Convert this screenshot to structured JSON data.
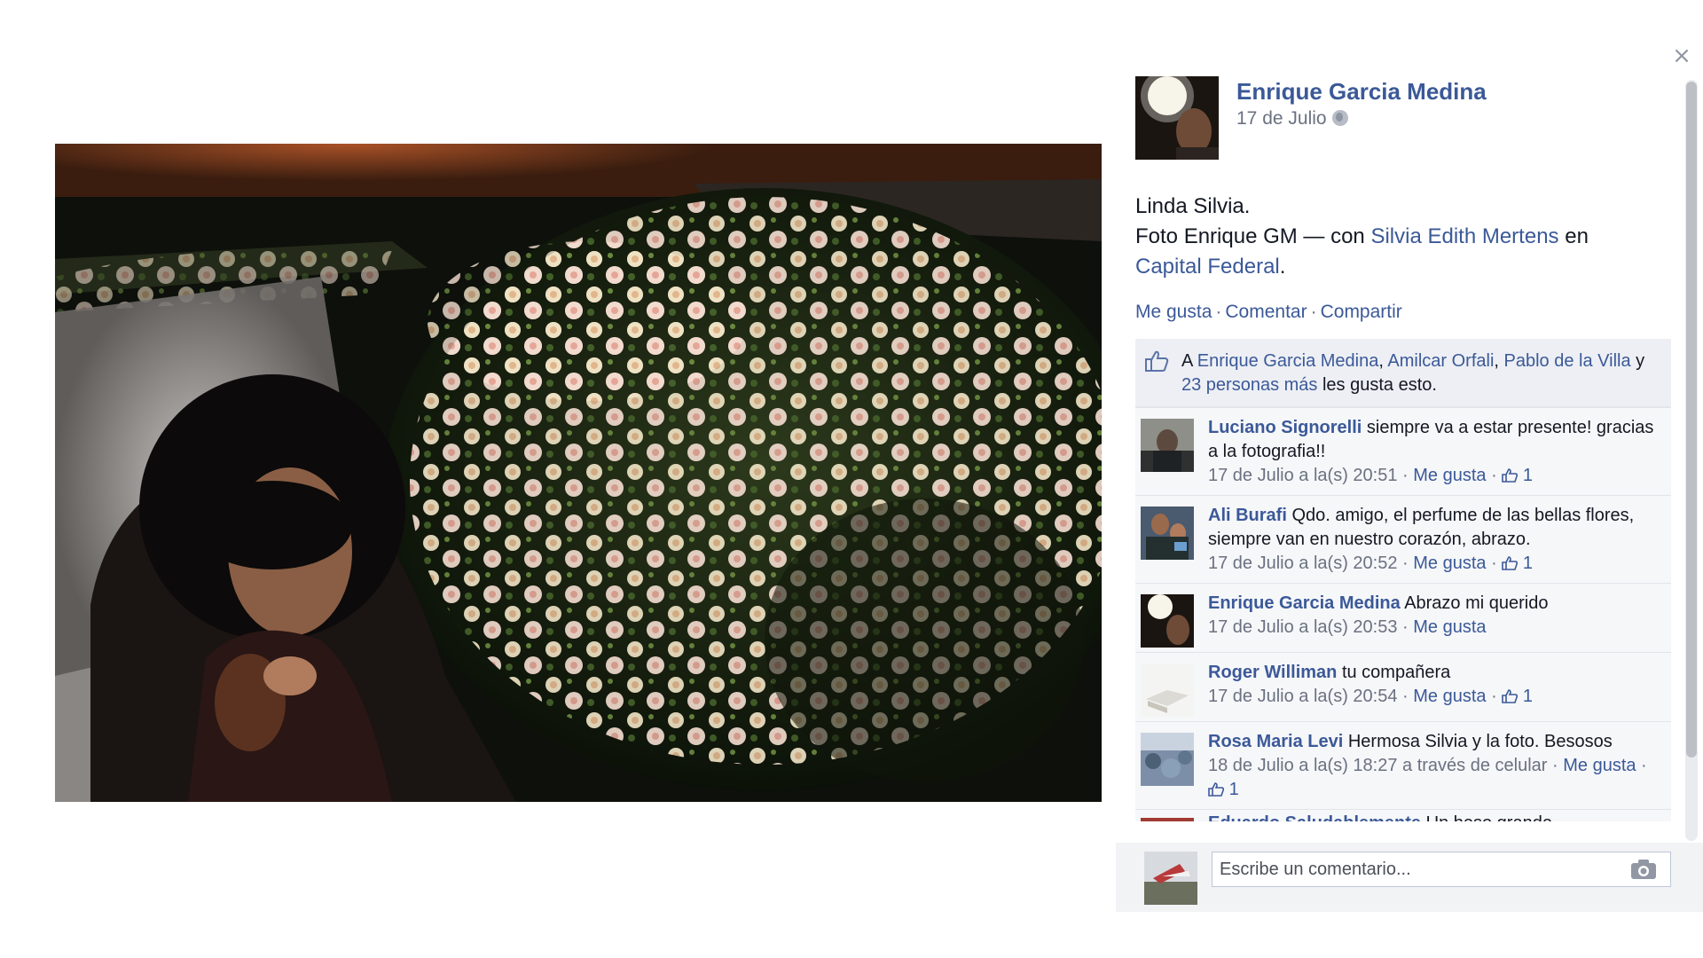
{
  "close_label": "×",
  "post": {
    "author": "Enrique Garcia Medina",
    "date": "17 de Julio",
    "privacy_icon": "globe-icon",
    "text_line1": "Linda Silvia.",
    "text_line2_prefix": "Foto Enrique GM — con ",
    "tagged_person": "Silvia Edith Mertens",
    "text_line2_mid": " en",
    "location": "Capital Federal",
    "text_end": "."
  },
  "actions": {
    "like": "Me gusta",
    "comment": "Comentar",
    "share": "Compartir",
    "separator": "·"
  },
  "likes": {
    "prefix": "A ",
    "person1": "Enrique Garcia Medina",
    "sep1": ", ",
    "person2": "Amilcar Orfali",
    "sep2": ", ",
    "person3": "Pablo de la Villa",
    "mid": " y ",
    "others": "23 personas más",
    "suffix": " les gusta esto."
  },
  "comments": [
    {
      "name": "Luciano Signorelli",
      "text": " siempre va a estar presente! gracias a la fotografia!!",
      "time": "17 de Julio a la(s) 20:51",
      "like_label": "Me gusta",
      "like_count": "1"
    },
    {
      "name": "Ali Burafi",
      "text": " Qdo. amigo, el perfume de las bellas flores, siempre van en nuestro corazón, abrazo.",
      "time": "17 de Julio a la(s) 20:52",
      "like_label": "Me gusta",
      "like_count": "1"
    },
    {
      "name": "Enrique Garcia Medina",
      "text": " Abrazo mi querido",
      "time": "17 de Julio a la(s) 20:53",
      "like_label": "Me gusta",
      "like_count": ""
    },
    {
      "name": "Roger Williman",
      "text": " tu compañera",
      "time": "17 de Julio a la(s) 20:54",
      "like_label": "Me gusta",
      "like_count": "1"
    },
    {
      "name": "Rosa Maria Levi",
      "text": " Hermosa Silvia y la foto. Besosos",
      "time": "18 de Julio a la(s) 18:27 a través de celular",
      "like_label": "Me gusta",
      "like_count": "1"
    }
  ],
  "partial_comment": {
    "name": "Eduardo Saludablemente",
    "text": " Un beso grande"
  },
  "composer": {
    "placeholder": "Escribe un comentario...",
    "icon": "camera-icon"
  },
  "colors": {
    "link": "#3b5998",
    "meta": "#6a7180",
    "comment_bg": "#f6f7f9",
    "likes_bg": "#edeff4"
  }
}
